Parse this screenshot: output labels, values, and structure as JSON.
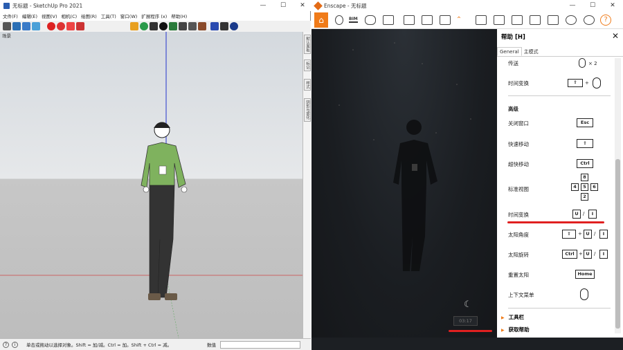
{
  "sketchup": {
    "title": "无标题 - SketchUp Pro 2021",
    "window_buttons": [
      "—",
      "☐",
      "✕"
    ],
    "menu": [
      "文件(F)",
      "编辑(E)",
      "视图(V)",
      "相机(C)",
      "绘图(R)",
      "工具(T)",
      "窗口(W)",
      "扩展程序 (x)",
      "帮助(H)"
    ],
    "scene_tab": "场景",
    "tray_tabs": [
      "默认面板",
      "标记",
      "样式",
      "阴影与雾化"
    ],
    "status_text": "单击或拖动以选择对象。Shift = 加/减。Ctrl = 加。Shift + Ctrl = 减。",
    "measurements_label": "数值"
  },
  "enscape": {
    "title": "Enscape - 无标题",
    "window_buttons": [
      "—",
      "☐",
      "✕"
    ],
    "toolbar_icons": [
      "home-icon",
      "map-pin-icon",
      "bim-icon",
      "binoculars-icon",
      "clapper-icon",
      "screenshot-icon",
      "panorama-icon",
      "video-icon",
      "collapse-icon",
      "book-icon",
      "library-icon",
      "settings-icon",
      "objects-icon",
      "views-icon",
      "visibility-icon",
      "gear-icon",
      "help-icon"
    ],
    "bim_label": "BIM",
    "time_display": "03:17",
    "help": {
      "title": "帮助 [H]",
      "close": "✕",
      "tabs": [
        "General",
        "主模式"
      ],
      "rows_top": [
        {
          "label": "传送",
          "suffix": "× 2"
        },
        {
          "label": "时间变换"
        }
      ],
      "section_advanced": "高级",
      "rows": [
        {
          "label": "关闭窗口",
          "keys": [
            "Esc"
          ]
        },
        {
          "label": "快速移动",
          "keys": [
            "⇧"
          ]
        },
        {
          "label": "超快移动",
          "keys": [
            "Ctrl"
          ]
        },
        {
          "label": "标准视图",
          "keys": [
            "8",
            "4",
            "5",
            "6",
            "2"
          ]
        },
        {
          "label": "时间变换",
          "keys": [
            "U",
            "/",
            "I"
          ]
        },
        {
          "label": "太阳角度",
          "keys": [
            "⇧",
            "+",
            "U",
            "/",
            "I"
          ]
        },
        {
          "label": "太阳旋转",
          "keys": [
            "Ctrl",
            "+",
            "U",
            "/",
            "I"
          ]
        },
        {
          "label": "重置太阳",
          "keys": [
            "Home"
          ]
        },
        {
          "label": "上下文菜单"
        }
      ],
      "footer": [
        {
          "label": "工具栏"
        },
        {
          "label": "获取帮助"
        }
      ]
    }
  }
}
